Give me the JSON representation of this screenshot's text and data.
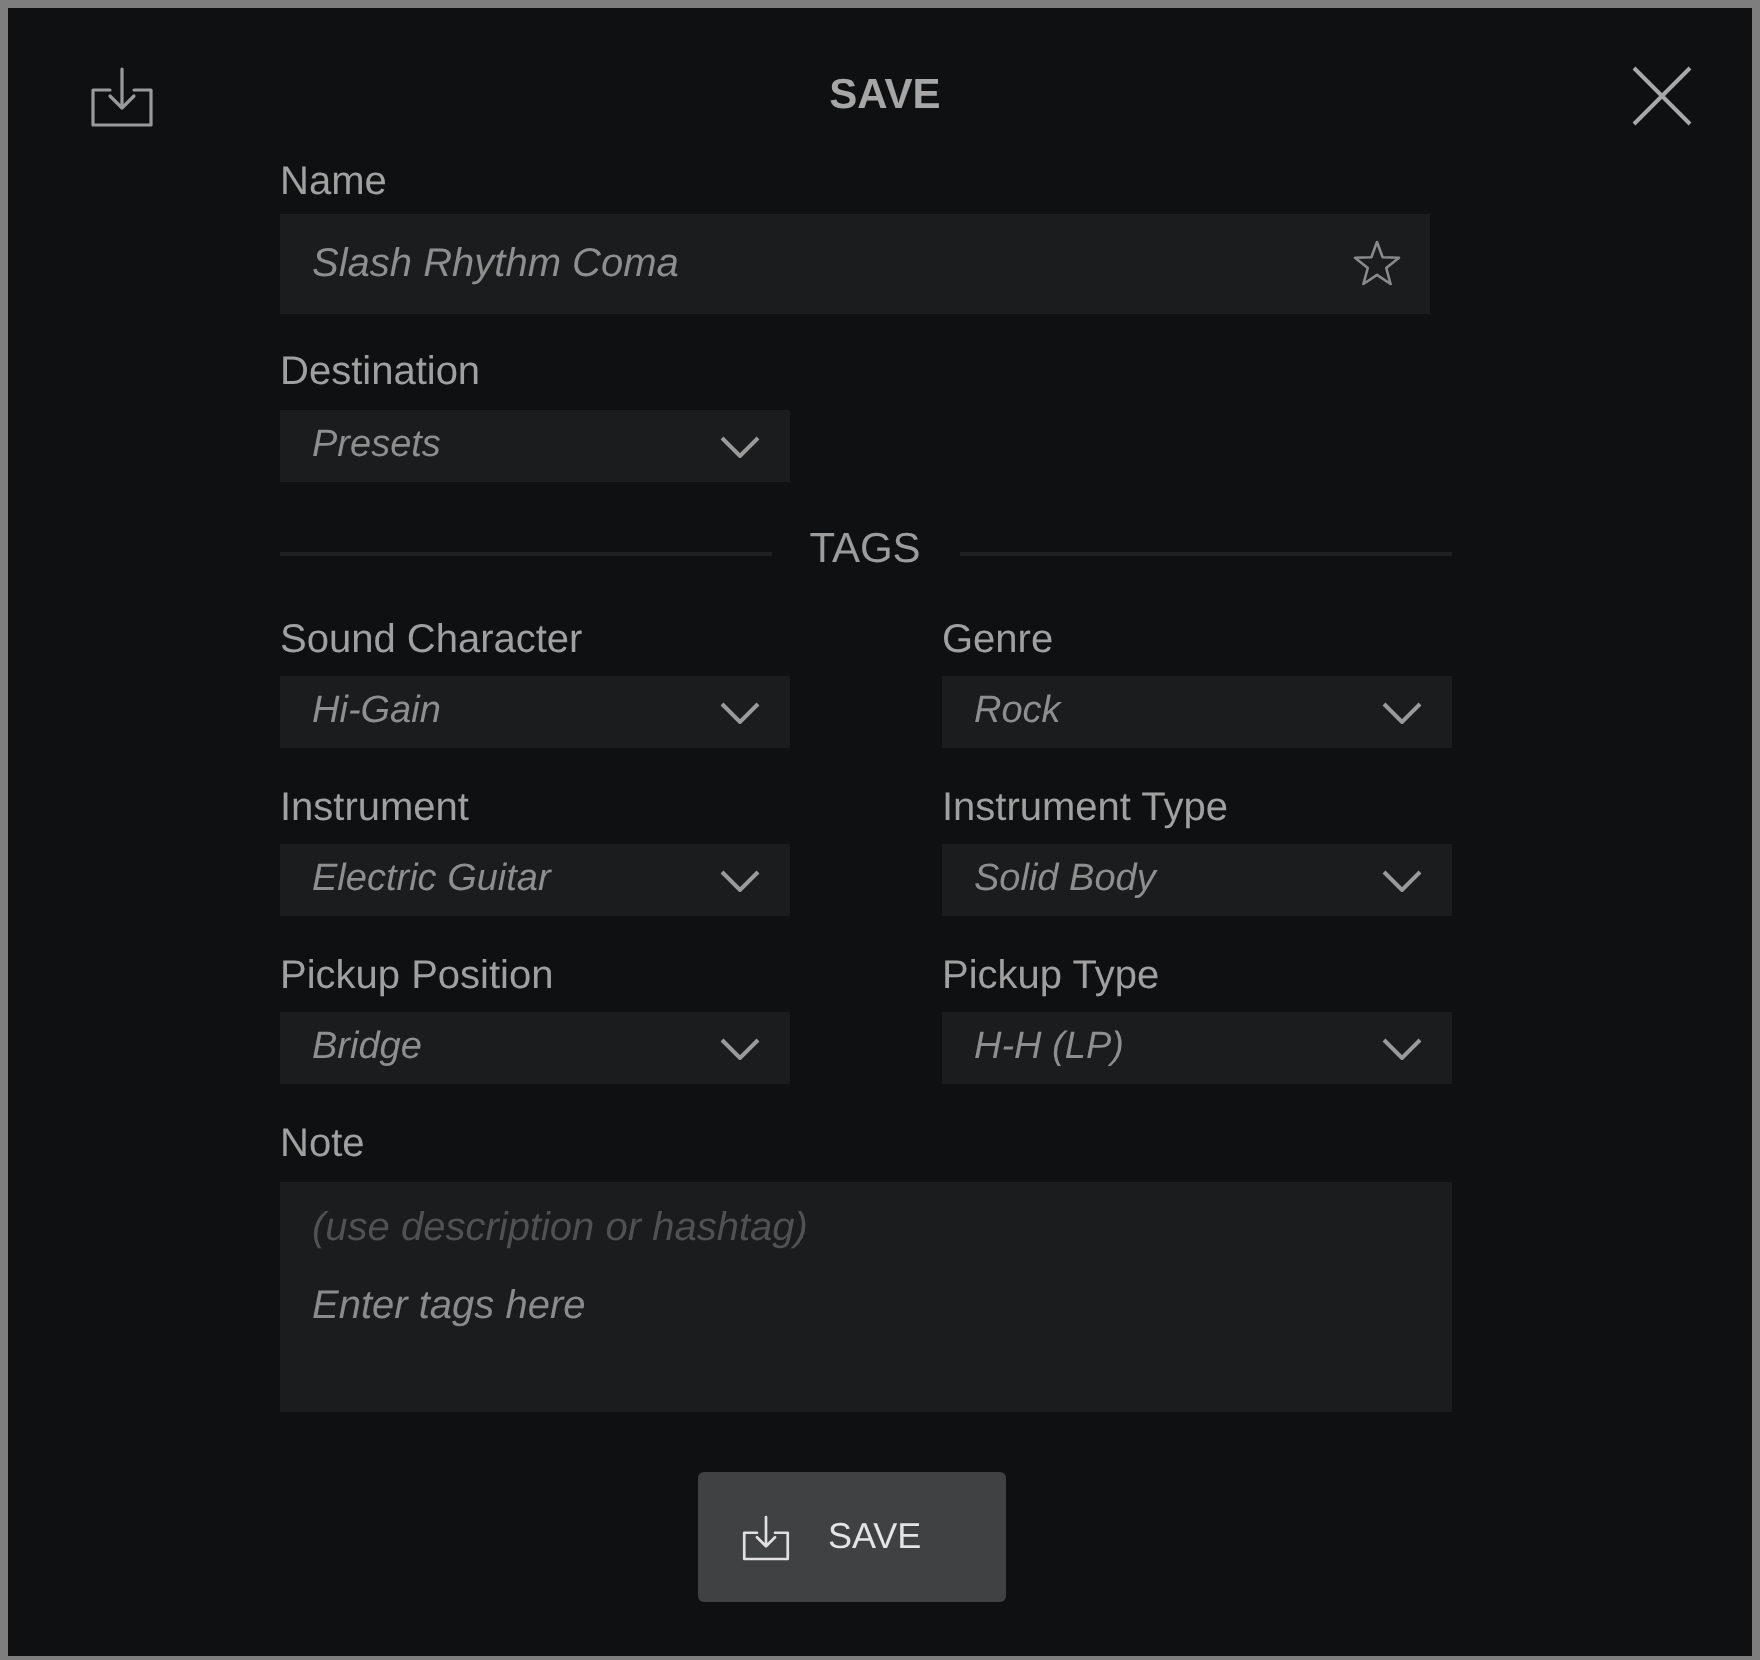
{
  "window": {
    "title": "SAVE"
  },
  "name": {
    "label": "Name",
    "value": "Slash Rhythm Coma",
    "favorite": false
  },
  "destination": {
    "label": "Destination",
    "value": "Presets"
  },
  "tags": {
    "heading": "TAGS",
    "fields": [
      {
        "label": "Sound Character",
        "value": "Hi-Gain"
      },
      {
        "label": "Genre",
        "value": "Rock"
      },
      {
        "label": "Instrument",
        "value": "Electric Guitar"
      },
      {
        "label": "Instrument Type",
        "value": "Solid Body"
      },
      {
        "label": "Pickup Position",
        "value": "Bridge"
      },
      {
        "label": "Pickup Type",
        "value": "H-H (LP)"
      }
    ]
  },
  "note": {
    "label": "Note",
    "hint": "(use description or hashtag)",
    "placeholder": "Enter tags here"
  },
  "save_button": {
    "label": "SAVE"
  }
}
